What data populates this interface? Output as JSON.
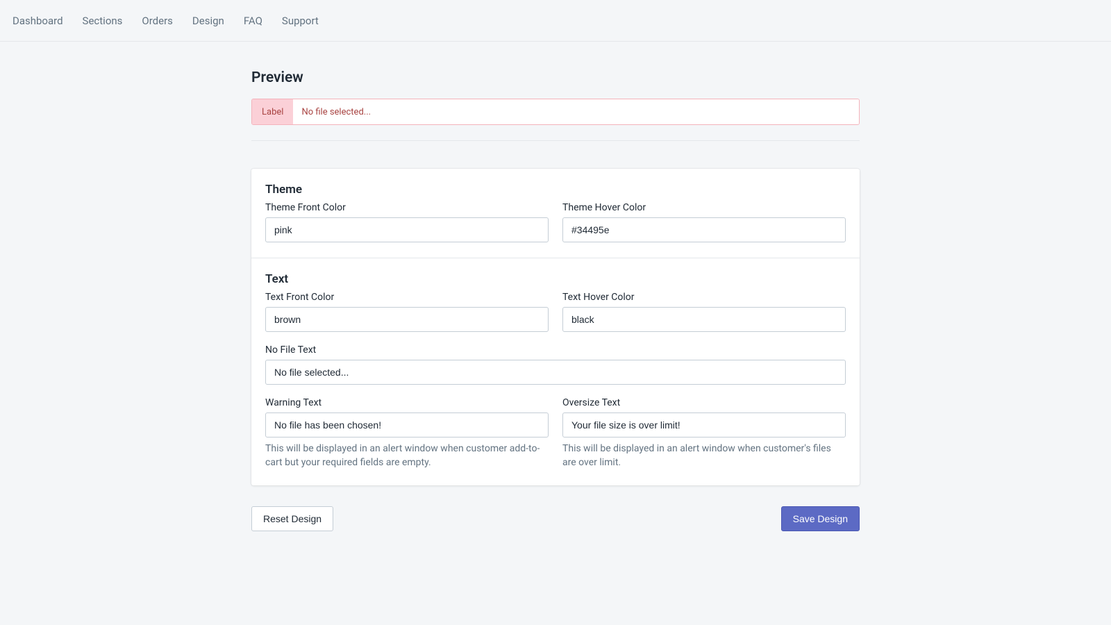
{
  "nav": {
    "items": [
      "Dashboard",
      "Sections",
      "Orders",
      "Design",
      "FAQ",
      "Support"
    ]
  },
  "preview": {
    "heading": "Preview",
    "label": "Label",
    "text": "No file selected..."
  },
  "theme": {
    "heading": "Theme",
    "frontLabel": "Theme Front Color",
    "frontValue": "pink",
    "hoverLabel": "Theme Hover Color",
    "hoverValue": "#34495e"
  },
  "text": {
    "heading": "Text",
    "frontLabel": "Text Front Color",
    "frontValue": "brown",
    "hoverLabel": "Text Hover Color",
    "hoverValue": "black",
    "noFileLabel": "No File Text",
    "noFileValue": "No file selected...",
    "warningLabel": "Warning Text",
    "warningValue": "No file has been chosen!",
    "warningHelp": "This will be displayed in an alert window when customer add-to-cart but your required fields are empty.",
    "oversizeLabel": "Oversize Text",
    "oversizeValue": "Your file size is over limit!",
    "oversizeHelp": "This will be displayed in an alert window when customer's files are over limit."
  },
  "actions": {
    "reset": "Reset Design",
    "save": "Save Design"
  }
}
